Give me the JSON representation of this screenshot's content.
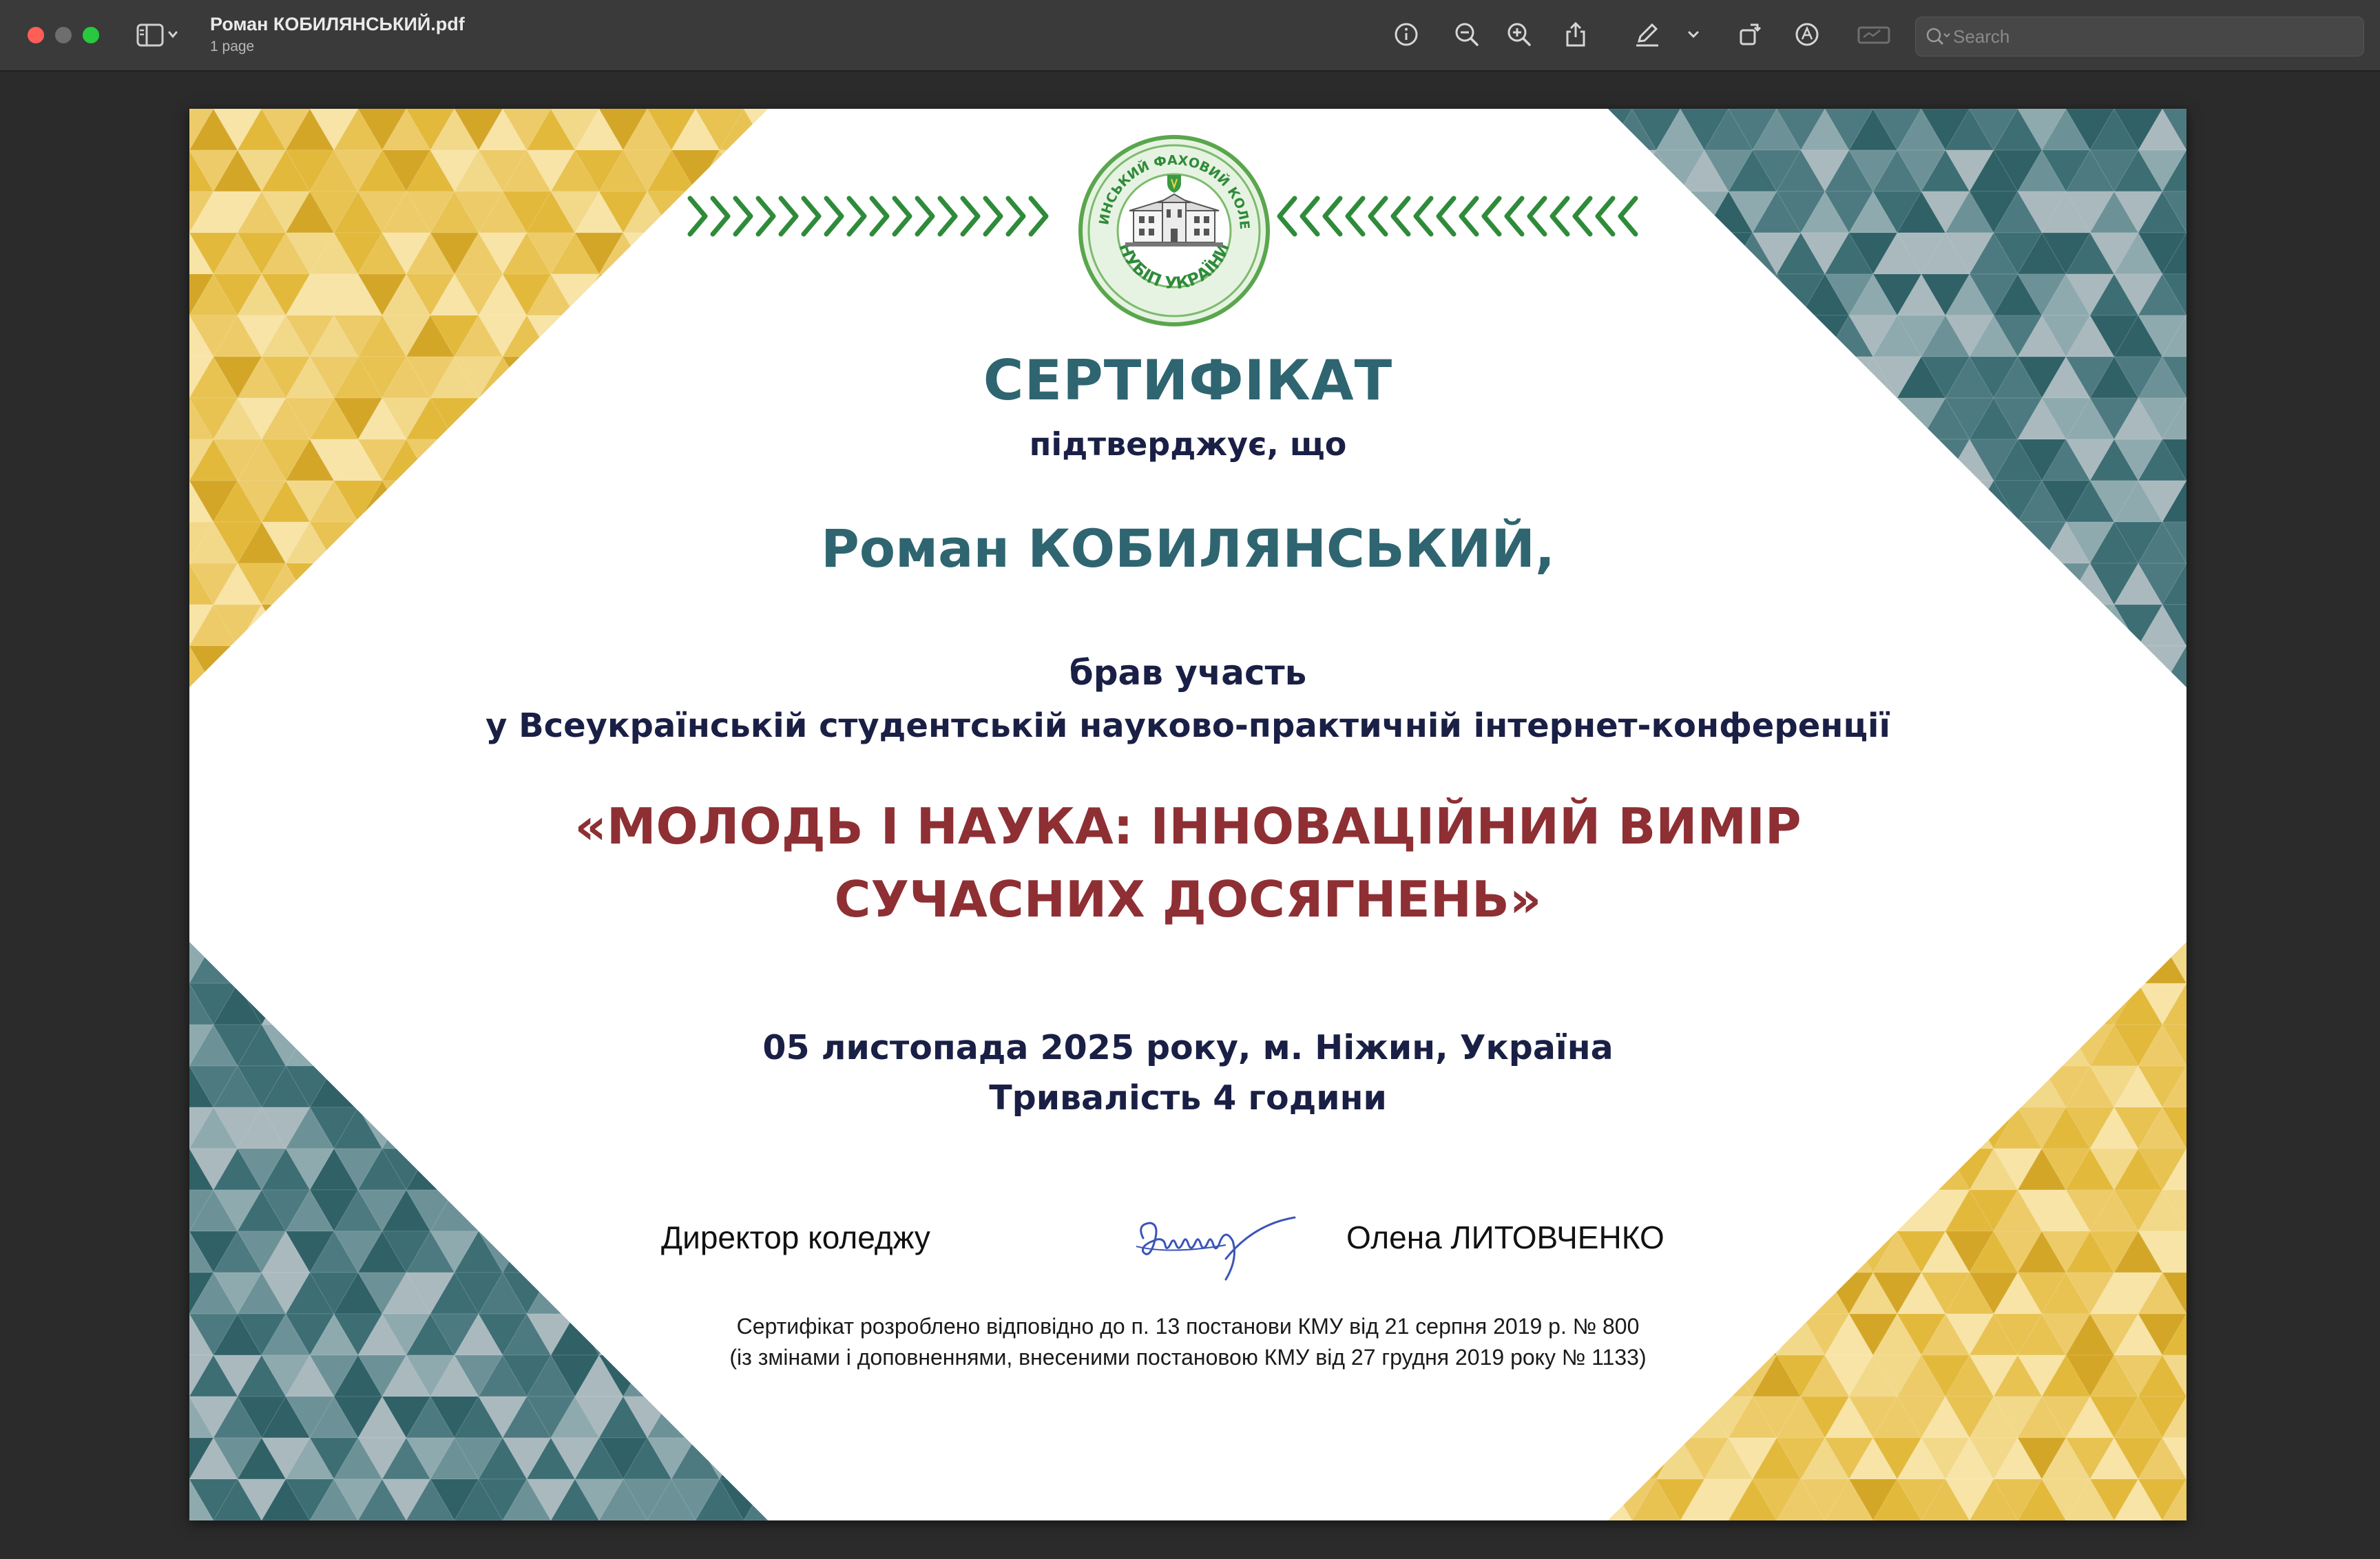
{
  "window": {
    "title": "Роман КОБИЛЯНСЬКИЙ.pdf",
    "subtitle": "1 page"
  },
  "toolbar": {
    "icons": [
      "info-icon",
      "zoom-out-icon",
      "zoom-in-icon",
      "share-icon",
      "markup-pen-icon",
      "chevron-down-icon",
      "rotate-icon",
      "annotate-icon",
      "sign-icon"
    ],
    "search_placeholder": "Search"
  },
  "certificate": {
    "title": "СЕРТИФІКАТ",
    "confirms": "підтверджує, що",
    "recipient": "Роман КОБИЛЯНСЬКИЙ,",
    "took_part": "брав участь",
    "conference": "у Всеукраїнській студентській науково-практичній інтернет-конференції",
    "theme_line1": "«МОЛОДЬ І НАУКА: ІННОВАЦІЙНИЙ ВИМІР",
    "theme_line2": "СУЧАСНИХ ДОСЯГНЕНЬ»",
    "date_place": "05 листопада 2025 року, м. Ніжин, Україна",
    "duration": "Тривалість 4 години",
    "signer_role": "Директор коледжу",
    "signer_name": "Олена ЛИТОВЧЕНКО",
    "note_line1": "Сертифікат розроблено відповідно до п. 13 постанови КМУ від 21 серпня 2019 р. № 800",
    "note_line2": "(із змінами і доповненнями, внесеними постановою КМУ від 27 грудня 2019 року № 1133)",
    "logo_text_top": "НІЖИНСЬКИЙ ФАХОВИЙ КОЛЕДЖ",
    "logo_text_bottom": "НУБІП УКРАЇНИ"
  },
  "colors": {
    "teal": "#2e6570",
    "navy": "#1a1f45",
    "maroon": "#8e2f34",
    "gold": "#e3b93c",
    "green": "#2f8b3a"
  }
}
